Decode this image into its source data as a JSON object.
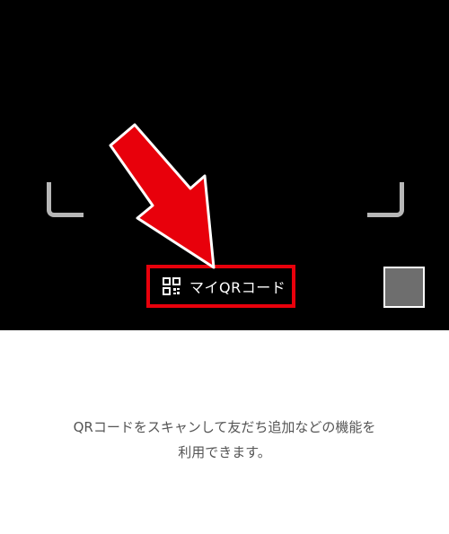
{
  "camera": {
    "background_color": "#000000",
    "frame_color": "#b7b7b7"
  },
  "my_qr": {
    "label": "マイQRコード",
    "icon": "qr-code-icon",
    "highlight_color": "#e8000b"
  },
  "annotation": {
    "arrow_icon": "red-arrow-icon",
    "color": "#e8000b"
  },
  "gallery": {
    "icon": "gallery-thumbnail",
    "color": "#6e6e6e"
  },
  "description": {
    "line1": "QRコードをスキャンして友だち追加などの機能を",
    "line2": "利用できます。"
  }
}
